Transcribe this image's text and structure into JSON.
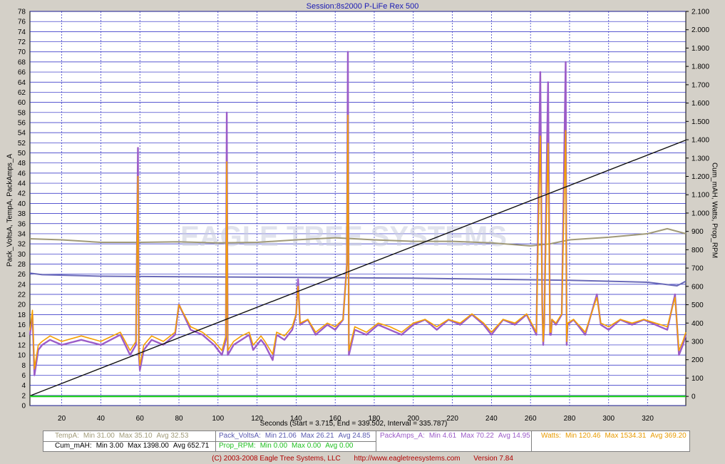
{
  "title": "Session:8s2000  P-LiFe Rex 500",
  "left_axis_label": "Pack_VoltsA, TempA, PackAmps_A",
  "right_axis_label": "Cum_mAH, Watts, Prop_RPM",
  "xlabel": "Seconds  (Start = 3.715,  End = 339.502,  Interval = 335.787)",
  "watermark": "EAGLE TREE SYSTEMS",
  "colors": {
    "plot_bg": "#ffffff",
    "grid": "#2020c0",
    "temp": "#a09a78",
    "volts": "#6a6ab8",
    "amps": "#9c5cc8",
    "watts": "#f5a000",
    "cum_mah": "#101010",
    "rpm": "#22d022"
  },
  "stats": {
    "temp": {
      "label": "TempA:",
      "min": "Min 31.00",
      "max": "Max 35.10",
      "avg": "Avg 32.53"
    },
    "volts": {
      "label": "Pack_VoltsA:",
      "min": "Min 21.06",
      "max": "Max 26.21",
      "avg": "Avg 24.85"
    },
    "amps": {
      "label": "PackAmps_A:",
      "min": "Min 4.61",
      "max": "Max 70.22",
      "avg": "Avg 14.95"
    },
    "watts": {
      "label": "Watts:",
      "min": "Min 120.46",
      "max": "Max 1534.31",
      "avg": "Avg 369.20"
    },
    "cum": {
      "label": "Cum_mAH:",
      "min": "Min 3.00",
      "max": "Max 1398.00",
      "avg": "Avg 652.71"
    },
    "rpm": {
      "label": "Prop_RPM:",
      "min": "Min 0.00",
      "max": "Max 0.00",
      "avg": "Avg 0.00"
    }
  },
  "footer": {
    "copyright": "(C) 2003-2008 Eagle Tree Systems, LLC",
    "url": "http://www.eagletreesystems.com",
    "version": "Version 7.84"
  },
  "chart_data": {
    "type": "line",
    "title": "Session:8s2000  P-LiFe Rex 500",
    "xlabel": "Seconds  (Start = 3.715,  End = 339.502,  Interval = 335.787)",
    "ylabel_left": "Pack_VoltsA, TempA, PackAmps_A",
    "ylabel_right": "Cum_mAH, Watts, Prop_RPM",
    "xlim": [
      3.715,
      339.502
    ],
    "ylim_left": [
      0,
      78
    ],
    "ylim_right": [
      -50,
      2100
    ],
    "x_ticks": [
      20,
      40,
      60,
      80,
      100,
      120,
      140,
      160,
      180,
      200,
      220,
      240,
      260,
      280,
      300,
      320
    ],
    "y_ticks_left": [
      0,
      2,
      4,
      6,
      8,
      10,
      12,
      14,
      16,
      18,
      20,
      22,
      24,
      26,
      28,
      30,
      32,
      34,
      36,
      38,
      40,
      42,
      44,
      46,
      48,
      50,
      52,
      54,
      56,
      58,
      60,
      62,
      64,
      66,
      68,
      70,
      72,
      74,
      76,
      78
    ],
    "y_ticks_right": [
      "0",
      "100",
      "200",
      "300",
      "400",
      "500",
      "600",
      "700",
      "800",
      "900",
      "1.000",
      "1.100",
      "1.200",
      "1.300",
      "1.400",
      "1.500",
      "1.600",
      "1.700",
      "1.800",
      "1.900",
      "2.000",
      "2.100"
    ],
    "y_ticks_right_values": [
      0,
      100,
      200,
      300,
      400,
      500,
      600,
      700,
      800,
      900,
      1000,
      1100,
      1200,
      1300,
      1400,
      1500,
      1600,
      1700,
      1800,
      1900,
      2000,
      2100
    ],
    "grid": true,
    "series": [
      {
        "name": "TempA",
        "axis": "left",
        "x": [
          3.7,
          20,
          40,
          60,
          80,
          100,
          120,
          140,
          160,
          180,
          200,
          220,
          240,
          260,
          270,
          280,
          300,
          320,
          330,
          339.5
        ],
        "values": [
          33.0,
          32.8,
          32.3,
          32.3,
          32.4,
          32.2,
          32.3,
          32.8,
          33.2,
          32.8,
          32.5,
          32.5,
          32.2,
          31.6,
          32.0,
          32.8,
          33.3,
          34.0,
          35.0,
          34.0
        ]
      },
      {
        "name": "Pack_VoltsA",
        "axis": "left",
        "x": [
          3.7,
          10,
          40,
          80,
          120,
          160,
          200,
          240,
          280,
          320,
          335,
          339.5
        ],
        "values": [
          26.2,
          25.9,
          25.6,
          25.5,
          25.4,
          25.3,
          25.2,
          25.0,
          24.8,
          24.4,
          23.7,
          24.6
        ]
      },
      {
        "name": "PackAmps_A",
        "axis": "left",
        "x": [
          3.7,
          5,
          6,
          8,
          10,
          14,
          20,
          30,
          40,
          50,
          55,
          58,
          59,
          59.5,
          60,
          62,
          66,
          72,
          78,
          80,
          86,
          92,
          98,
          102,
          104,
          104.5,
          105,
          108,
          112,
          116,
          118,
          122,
          124,
          128,
          130,
          134,
          138,
          140,
          141,
          142,
          146,
          150,
          156,
          160,
          164,
          166,
          166.5,
          167,
          170,
          176,
          182,
          188,
          194,
          200,
          206,
          212,
          218,
          224,
          230,
          236,
          240,
          246,
          252,
          258,
          263,
          265,
          266,
          266.5,
          267,
          269,
          270,
          270.5,
          271,
          273,
          276,
          278,
          278.5,
          279,
          282,
          288,
          294,
          296,
          300,
          306,
          312,
          318,
          324,
          330,
          334,
          336,
          338,
          339.5
        ],
        "values": [
          14,
          18,
          6,
          11,
          12,
          13,
          12,
          13,
          12,
          14,
          10,
          12,
          51,
          10,
          7,
          11,
          13,
          12,
          14,
          20,
          15,
          14,
          12,
          10,
          13,
          58,
          10,
          12,
          13,
          14,
          11,
          13,
          12,
          9,
          14,
          13,
          15,
          18,
          25,
          16,
          17,
          14,
          16,
          15,
          17,
          28,
          70,
          10,
          15,
          14,
          16,
          15,
          14,
          16,
          17,
          15,
          17,
          16,
          18,
          16,
          14,
          17,
          16,
          18,
          14,
          66,
          20,
          12,
          16,
          64,
          14,
          14,
          17,
          16,
          18,
          68,
          12,
          16,
          17,
          14,
          22,
          16,
          15,
          17,
          16,
          17,
          16,
          15,
          22,
          10,
          12,
          14
        ]
      },
      {
        "name": "Watts",
        "axis": "right",
        "x": [
          3.7,
          5,
          6,
          8,
          10,
          14,
          20,
          30,
          40,
          50,
          55,
          58,
          59,
          59.5,
          60,
          62,
          66,
          72,
          78,
          80,
          86,
          92,
          98,
          102,
          104,
          104.5,
          105,
          108,
          112,
          116,
          118,
          122,
          124,
          128,
          130,
          134,
          138,
          140,
          141,
          142,
          146,
          150,
          156,
          160,
          164,
          166,
          166.5,
          167,
          170,
          176,
          182,
          188,
          194,
          200,
          206,
          212,
          218,
          224,
          230,
          236,
          240,
          246,
          252,
          258,
          263,
          265,
          266,
          266.5,
          267,
          269,
          270,
          270.5,
          271,
          273,
          276,
          278,
          278.5,
          279,
          282,
          288,
          294,
          296,
          300,
          306,
          312,
          318,
          324,
          330,
          334,
          336,
          338,
          339.5
        ],
        "values": [
          360,
          470,
          150,
          280,
          300,
          330,
          300,
          330,
          300,
          350,
          250,
          300,
          1200,
          250,
          170,
          280,
          330,
          300,
          350,
          500,
          380,
          350,
          300,
          250,
          330,
          1280,
          250,
          300,
          330,
          350,
          280,
          330,
          300,
          230,
          350,
          330,
          380,
          450,
          600,
          400,
          420,
          350,
          400,
          380,
          420,
          700,
          1534,
          250,
          380,
          350,
          400,
          380,
          350,
          400,
          420,
          380,
          420,
          400,
          450,
          400,
          350,
          420,
          400,
          450,
          350,
          1420,
          500,
          300,
          400,
          1380,
          350,
          350,
          420,
          400,
          450,
          1450,
          300,
          400,
          420,
          350,
          540,
          400,
          380,
          420,
          400,
          420,
          400,
          380,
          540,
          250,
          300,
          350
        ]
      },
      {
        "name": "Cum_mAH",
        "axis": "right",
        "x": [
          3.715,
          339.502
        ],
        "values": [
          3,
          1398
        ]
      },
      {
        "name": "Prop_RPM",
        "axis": "right",
        "x": [
          3.715,
          339.502
        ],
        "values": [
          0,
          0
        ]
      }
    ]
  }
}
